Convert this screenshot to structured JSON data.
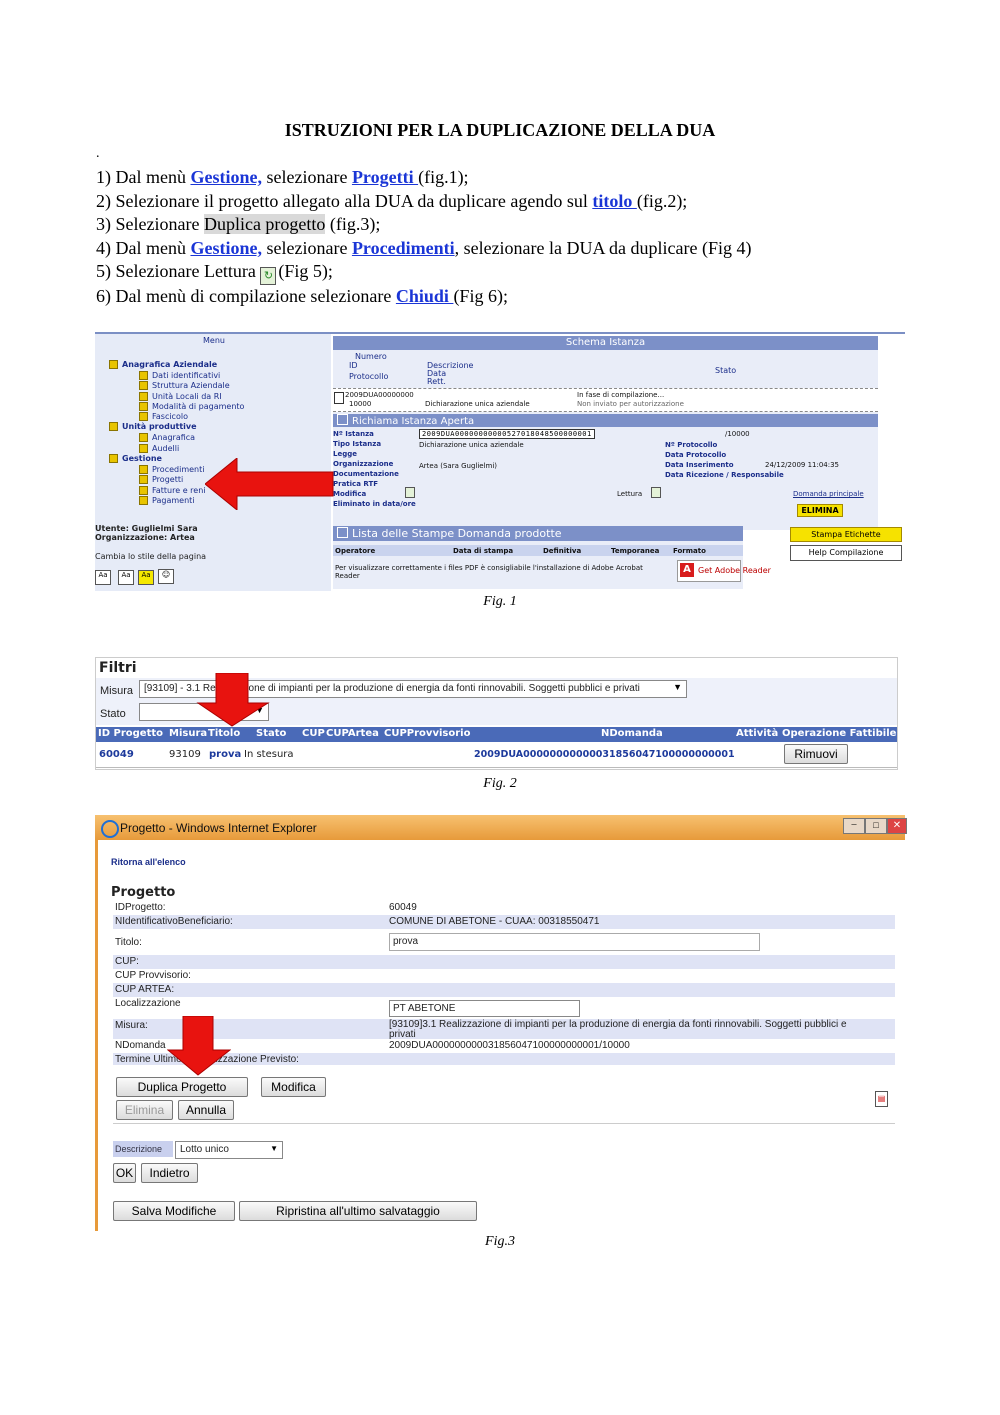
{
  "title": "ISTRUZIONI PER LA DUPLICAZIONE DELLA DUA",
  "dot": ".",
  "steps": [
    {
      "pre": "1) Dal menù ",
      "link1": "Gestione,",
      "mid": " selezionare ",
      "link2": "Progetti ",
      "post": "(fig.1);"
    },
    {
      "pre": "2) Selezionare il progetto allegato alla DUA da duplicare agendo sul ",
      "link1": "titolo ",
      "post": "(fig.2);"
    },
    {
      "pre": "3) Selezionare ",
      "hl": "Duplica progetto",
      "post": " (fig.3);"
    },
    {
      "pre": "4) Dal menù ",
      "link1": "Gestione,",
      "mid": " selezionare ",
      "link2": "Procedimenti",
      "post": ", selezionare la DUA da duplicare (Fig 4)"
    },
    {
      "pre": "5) Selezionare Lettura ",
      "post": "(Fig 5);"
    },
    {
      "pre": "6) Dal menù di compilazione selezionare ",
      "link1": "Chiudi ",
      "post": "(Fig 6);"
    }
  ],
  "fig1": {
    "caption": "Fig. 1",
    "menu_title": "Menu",
    "menu": [
      {
        "label": "Anagrafica Aziendale",
        "level": 0
      },
      {
        "label": "Dati identificativi",
        "level": 1
      },
      {
        "label": "Struttura Aziendale",
        "level": 1
      },
      {
        "label": "Unità Locali da RI",
        "level": 1
      },
      {
        "label": "Modalità di pagamento",
        "level": 1
      },
      {
        "label": "Fascicolo",
        "level": 1
      },
      {
        "label": "Unità produttive",
        "level": 0
      },
      {
        "label": "Anagrafica",
        "level": 1
      },
      {
        "label": "Audelli",
        "level": 1
      },
      {
        "label": "Gestione",
        "level": 0
      },
      {
        "label": "Procedimenti",
        "level": 1
      },
      {
        "label": "Progetti",
        "level": 1
      },
      {
        "label": "Fatture e reni",
        "level": 1
      },
      {
        "label": "Pagamenti",
        "level": 1
      }
    ],
    "user": "Utente: Guglielmi Sara",
    "org": "Organizzazione: Artea",
    "style_label": "Cambia lo stile della pagina",
    "style_buttons": [
      "Aa",
      "Aa",
      "Aa"
    ],
    "schema_title": "Schema Istanza",
    "schema_headers": {
      "numero": "Numero",
      "id": "ID",
      "protocollo": "Protocollo",
      "descrizione": "Descrizione",
      "data": "Data",
      "rett": "Rett.",
      "stato": "Stato"
    },
    "schema_row": {
      "num": "2009DUA00000000",
      "id": "10000",
      "descr": "Dichiarazione unica aziendale",
      "stato": "In fase di compilazione...",
      "stato2": "Non inviato per autorizzazione"
    },
    "richiama_title": "Richiama Istanza Aperta",
    "fields_left": [
      "Nº Istanza",
      "Tipo Istanza",
      "Legge",
      "Organizzazione",
      "Documentazione",
      "Pratica RTF",
      "Modifica",
      "Eliminato in data/ore"
    ],
    "istanza_code": "2009DUA00000000000527018048500000001",
    "istanza_suffix": "/10000",
    "tipo_value": "Dichiarazione unica aziendale",
    "org_value": "Artea (Sara Guglielmi)",
    "fields_right": [
      "Nº Protocollo",
      "Data Protocollo",
      "Data Inserimento",
      "Data Ricezione / Responsabile"
    ],
    "data_inserimento": "24/12/2009 11:04:35",
    "lettura": "Lettura",
    "domanda_principale": "Domanda principale",
    "elimina": "ELIMINA",
    "stampe_title": "Lista delle Stampe Domanda prodotte",
    "stampe_headers": [
      "Operatore",
      "Data di stampa",
      "Definitiva",
      "Temporanea",
      "Formato"
    ],
    "stampe_note": "Per visualizzare correttamente i files PDF è consigliabile l'installazione di Adobe Acrobat Reader",
    "adobe": "Get Adobe Reader",
    "btn_stampa": "Stampa Etichette",
    "btn_help": "Help Compilazione"
  },
  "fig2": {
    "caption": "Fig. 2",
    "filtri": "Filtri",
    "misura_label": "Misura",
    "misura_value": "[93109] - 3.1 Realizzazione di impianti per la produzione di energia da fonti rinnovabili. Soggetti pubblici e privati",
    "stato_label": "Stato",
    "headers": [
      "ID Progetto",
      "Misura",
      "Titolo",
      "Stato",
      "CUP",
      "CUPArtea",
      "CUPProvvisorio",
      "NDomanda",
      "Attività",
      "Operazione Fattibile"
    ],
    "row": {
      "id": "60049",
      "misura": "93109",
      "titolo": "prova",
      "stato": "In stesura",
      "ndomanda": "2009DUA00000000000031856047100000000001",
      "btn": "Rimuovi"
    }
  },
  "fig3": {
    "caption": "Fig.3",
    "window_title": "Progetto - Windows Internet Explorer",
    "back_link": "Ritorna all'elenco",
    "heading": "Progetto",
    "rows": [
      {
        "label": "IDProgetto:",
        "value": "60049"
      },
      {
        "label": "NIdentificativoBeneficiario:",
        "value": "COMUNE DI ABETONE - CUAA: 00318550471"
      },
      {
        "label": "Titolo:",
        "value": "prova"
      },
      {
        "label": "CUP:",
        "value": ""
      },
      {
        "label": "CUP Provvisorio:",
        "value": ""
      },
      {
        "label": "CUP ARTEA:",
        "value": ""
      },
      {
        "label": "Localizzazione",
        "value": "PT ABETONE"
      },
      {
        "label": "Misura:",
        "value": "[93109]3.1 Realizzazione di impianti per la produzione di energia da fonti rinnovabili. Soggetti pubblici e privati"
      },
      {
        "label": "NDomanda",
        "value": "2009DUA000000000031856047100000000001/10000"
      },
      {
        "label": "Termine Ultimo di Realizzazione Previsto:",
        "value": ""
      }
    ],
    "btn_duplica": "Duplica Progetto",
    "btn_modifica": "Modifica",
    "btn_elimina": "Elimina",
    "btn_annulla": "Annulla",
    "descr_label": "Descrizione",
    "descr_value": "Lotto unico",
    "btn_ok": "OK",
    "btn_indietro": "Indietro",
    "btn_salva": "Salva Modifiche",
    "btn_ripristina": "Ripristina all'ultimo salvataggio"
  },
  "colors": {
    "link": "#1a35d6",
    "arrow": "#e8130f",
    "header_blue": "#7c90c8",
    "ie_bar": "#f0ad55"
  }
}
